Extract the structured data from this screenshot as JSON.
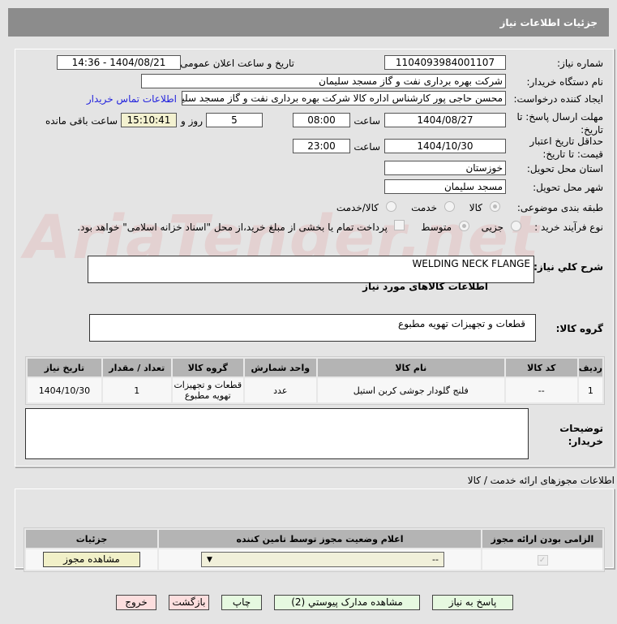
{
  "header": {
    "title": "جزئیات اطلاعات نیاز"
  },
  "watermark": "AriaTender.net",
  "fields": {
    "need_number_label": "شماره نیاز:",
    "need_number": "1104093984001107",
    "announce_label": "تاریخ و ساعت اعلان عمومی:",
    "announce": "1404/08/21 - 14:36",
    "buyer_label": "نام دستگاه خریدار:",
    "buyer": "شرکت بهره برداری نفت و گاز مسجد سلیمان",
    "creator_label": "ایجاد کننده درخواست:",
    "creator": "محسن حاجی پور کارشناس اداره کالا  شرکت بهره برداری نفت و گاز مسجد سلیمان",
    "contact_link": "اطلاعات تماس خریدار",
    "deadline_label": "مهلت ارسال پاسخ: تا تاریخ:",
    "deadline_date": "1404/08/27",
    "time_label": "ساعت",
    "deadline_time": "08:00",
    "days": "5",
    "days_label": "روز و",
    "remaining": "15:10:41",
    "remaining_label": "ساعت باقی مانده",
    "validity_label": "حداقل تاریخ اعتبار قیمت: تا تاریخ:",
    "validity_date": "1404/10/30",
    "validity_time": "23:00",
    "province_label": "استان محل تحویل:",
    "province": "خوزستان",
    "city_label": "شهر محل تحویل:",
    "city": "مسجد سلیمان",
    "category_label": "طبقه بندی موضوعی:",
    "category_options": [
      "کالا",
      "خدمت",
      "کالا/خدمت"
    ],
    "category_selected": "کالا",
    "process_label": "نوع فرآیند خرید :",
    "process_options": [
      "جزیی",
      "متوسط"
    ],
    "process_selected": "متوسط",
    "payment_note": "پرداخت تمام یا بخشی از مبلغ خرید،از محل \"اسناد خزانه اسلامی\" خواهد بود."
  },
  "description": {
    "label": "شرح كلي نياز:",
    "value": "WELDING NECK FLANGE"
  },
  "goods_title": "اطلاعات کالاهای مورد نیاز",
  "group": {
    "label": "گروه کالا:",
    "value": "قطعات و تجهیزات تهویه مطبوع"
  },
  "items_table": {
    "headers": [
      "ردیف",
      "کد کالا",
      "نام کالا",
      "واحد شمارش",
      "گروه کالا",
      "تعداد / مقدار",
      "تاریخ نیاز"
    ],
    "rows": [
      [
        "1",
        "--",
        "فلنج گلودار جوشی کربن استیل",
        "عدد",
        "قطعات و تجهیزات تهویه مطبوع",
        "1",
        "1404/10/30"
      ]
    ]
  },
  "notes_label": "توضیحات خریدار:",
  "permits": {
    "title": "اطلاعات مجوزهای ارائه خدمت / کالا",
    "headers": [
      "الزامی بودن ارائه مجوز",
      "اعلام وضعیت مجوز توسط تامین کننده",
      "جزئیات"
    ],
    "select_value": "--",
    "view_button": "مشاهده مجوز",
    "required_checked": true
  },
  "buttons": {
    "reply": "پاسخ به نیاز",
    "attachments": "مشاهده مدارک پیوستي (2)",
    "print": "چاپ",
    "back": "بازگشت",
    "exit": "خروج"
  }
}
